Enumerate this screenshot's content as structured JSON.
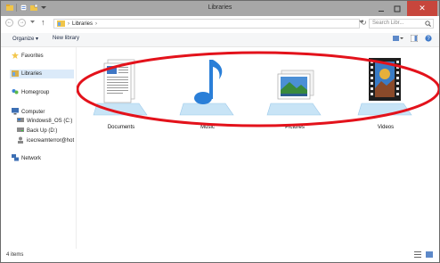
{
  "window": {
    "title": "Libraries"
  },
  "address": {
    "crumb": "Libraries",
    "search_placeholder": "Search Libr..."
  },
  "toolbar": {
    "organize": "Organize",
    "new_library": "New library"
  },
  "nav": {
    "favorites": "Favorites",
    "libraries": "Libraries",
    "homegroup": "Homegroup",
    "computer": "Computer",
    "drive_c": "Windows8_OS (C:)",
    "drive_d": "Back Up (D:)",
    "user": "icecreamterror@hot",
    "network": "Network"
  },
  "libraries": [
    {
      "label": "Documents"
    },
    {
      "label": "Music"
    },
    {
      "label": "Pictures"
    },
    {
      "label": "Videos"
    }
  ],
  "status": {
    "count": "4 items"
  },
  "colors": {
    "annotation": "#e3121b",
    "title_bar": "#a7a7a7",
    "close": "#c7463c"
  }
}
